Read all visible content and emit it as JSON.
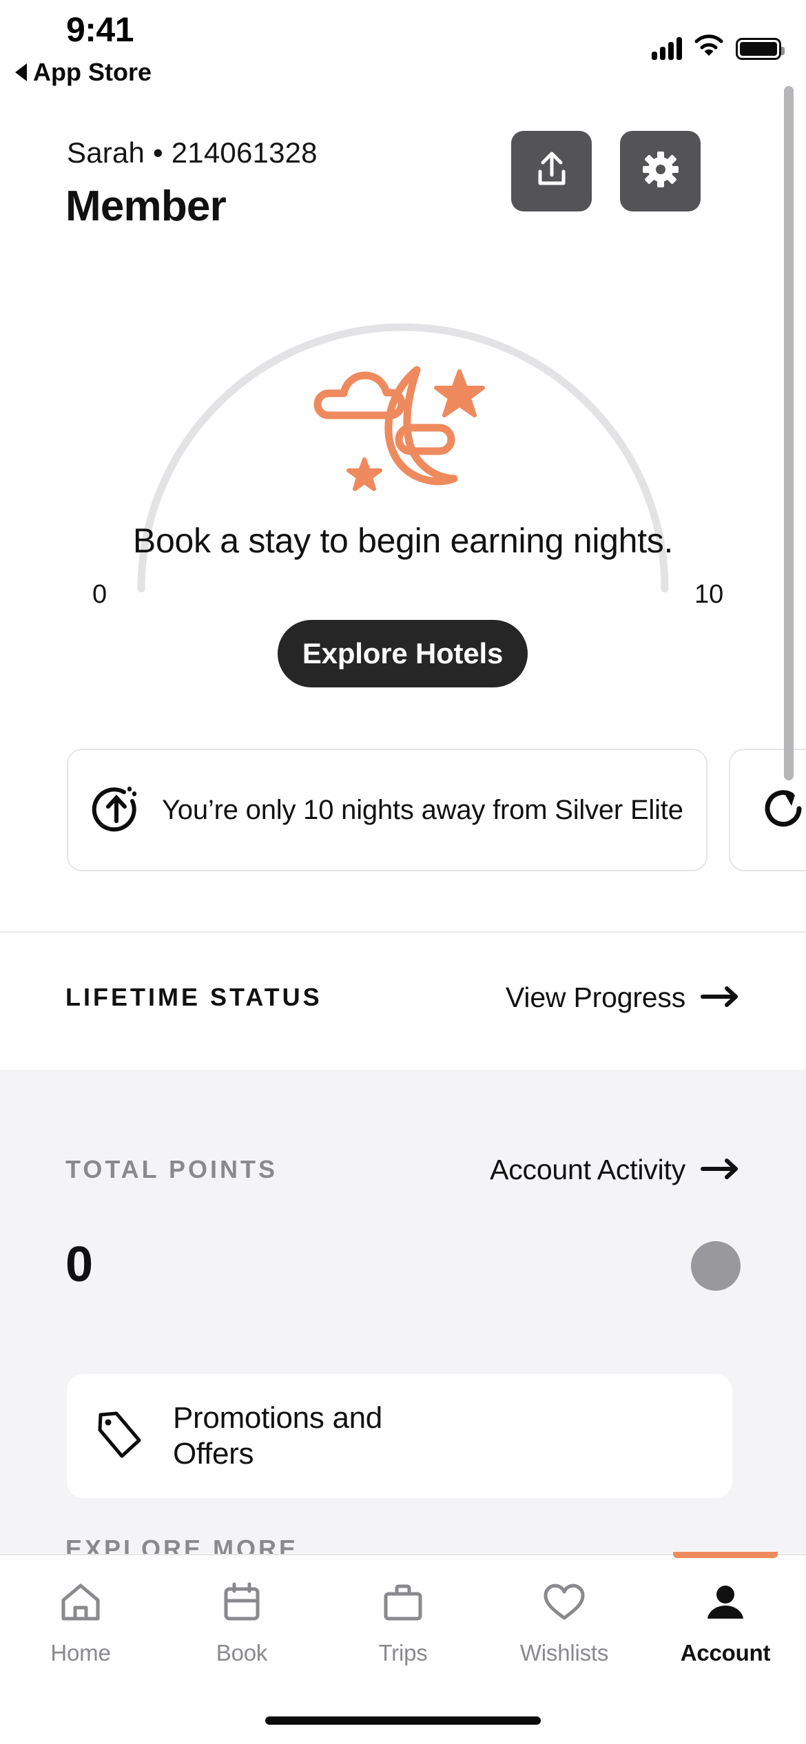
{
  "status_bar": {
    "time": "9:41",
    "back_label": "App Store",
    "signal_bars": 4,
    "wifi": "wifi-icon",
    "battery": "full"
  },
  "header": {
    "identity": "Sarah • 214061328",
    "tier_title": "Member",
    "share_icon": "share-icon",
    "settings_icon": "gear-icon",
    "button_bg": "#545457"
  },
  "gauge": {
    "min_label": "0",
    "max_label": "10",
    "icon": "moon-stars-icon",
    "icon_color": "#EE8A5E",
    "track_color": "#E3E3E5",
    "headline": "Book a stay to begin earning nights.",
    "cta_label": "Explore Hotels"
  },
  "carousel": {
    "cards": [
      {
        "icon": "arrow-up-progress-icon",
        "text": "You’re only 10 nights away from Silver Elite"
      },
      {
        "icon": "refresh-icon",
        "text": ""
      }
    ]
  },
  "lifetime_status": {
    "label": "LIFETIME STATUS",
    "link_label": "View Progress",
    "link_icon": "arrow-right-icon"
  },
  "total_points": {
    "label": "TOTAL POINTS",
    "link_label": "Account Activity",
    "link_icon": "arrow-right-icon",
    "value": "0"
  },
  "promotions": {
    "icon": "tag-icon",
    "label": "Promotions and Offers"
  },
  "explore_more": {
    "label": "EXPLORE MORE"
  },
  "tab_bar": {
    "accent": "#EE8A5E",
    "items": [
      {
        "label": "Home",
        "icon": "house-icon",
        "active": false
      },
      {
        "label": "Book",
        "icon": "calendar-icon",
        "active": false
      },
      {
        "label": "Trips",
        "icon": "briefcase-icon",
        "active": false
      },
      {
        "label": "Wishlists",
        "icon": "heart-icon",
        "active": false
      },
      {
        "label": "Account",
        "icon": "person-icon",
        "active": true
      }
    ]
  }
}
